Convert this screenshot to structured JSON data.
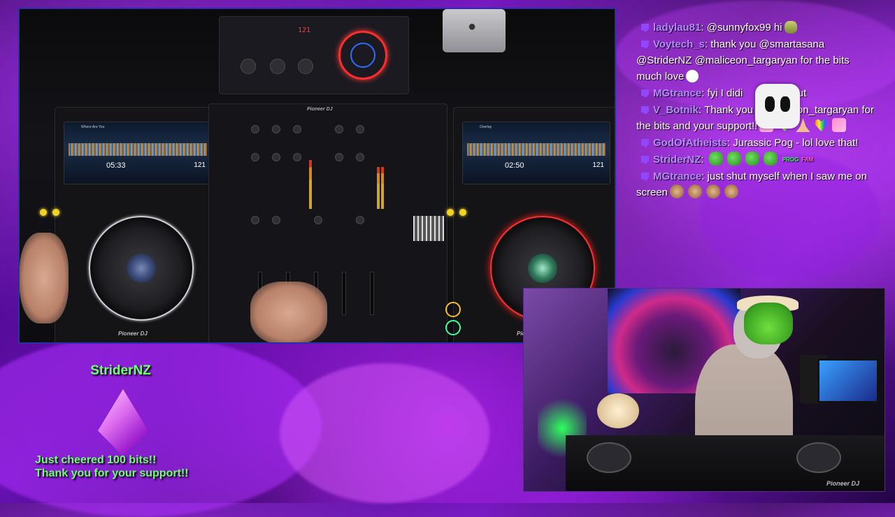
{
  "colors": {
    "background_purple": "#6a12b8",
    "alert_green": "#6dff6d",
    "twitch_badge": "#9146ff",
    "username_purple": "#b48cff",
    "frame_border": "#2b2ea8"
  },
  "main_camera": {
    "top_unit_display": "121",
    "left_deck": {
      "brand": "Pioneer DJ",
      "track_title": "Where Are You",
      "time": "05:33",
      "bpm": "121"
    },
    "right_deck": {
      "brand": "Pioneer DJ",
      "track_title": "Overlay",
      "time": "02:50",
      "bpm": "121"
    },
    "mixer_brand": "Pioneer DJ"
  },
  "chat": {
    "messages": [
      {
        "user": "ladylau81",
        "text": "@sunnyfox99 hi",
        "emotes": [
          "bag"
        ]
      },
      {
        "user": "Voytech_s",
        "text": "thank you @smartasana @StriderNZ @maliceon_targaryan for the bits much love",
        "emotes": [
          "ghost"
        ]
      },
      {
        "user": "MGtrance",
        "text": "fyi I didn't mean to ruin it",
        "display_text": "fyi I didi",
        "trailing": "nut",
        "emotes": []
      },
      {
        "user": "V_Botnik",
        "text": "Thank you @maliceon_targaryan for the bits and your support!!",
        "emotes": [
          "pink",
          "heart",
          "pray",
          "heart",
          "pink"
        ]
      },
      {
        "user": "GodOfAtheists",
        "text": "Jurassic Pog - lol love that!",
        "emotes": []
      },
      {
        "user": "StriderNZ",
        "text": "",
        "emotes": [
          "green",
          "green",
          "green",
          "green",
          "prog",
          "fam"
        ]
      },
      {
        "user": "MGtrance",
        "text": "just shut myself when I saw me on screen",
        "emotes": [
          "face",
          "face",
          "face",
          "face"
        ]
      }
    ],
    "emote_text": {
      "prog": "PROG",
      "fam": "FAM"
    }
  },
  "alert": {
    "username": "StriderNZ",
    "line1": "Just cheered 100 bits!!",
    "line2": "Thank you for your support!!"
  },
  "webcam": {
    "gear_brand": "Pioneer DJ"
  }
}
